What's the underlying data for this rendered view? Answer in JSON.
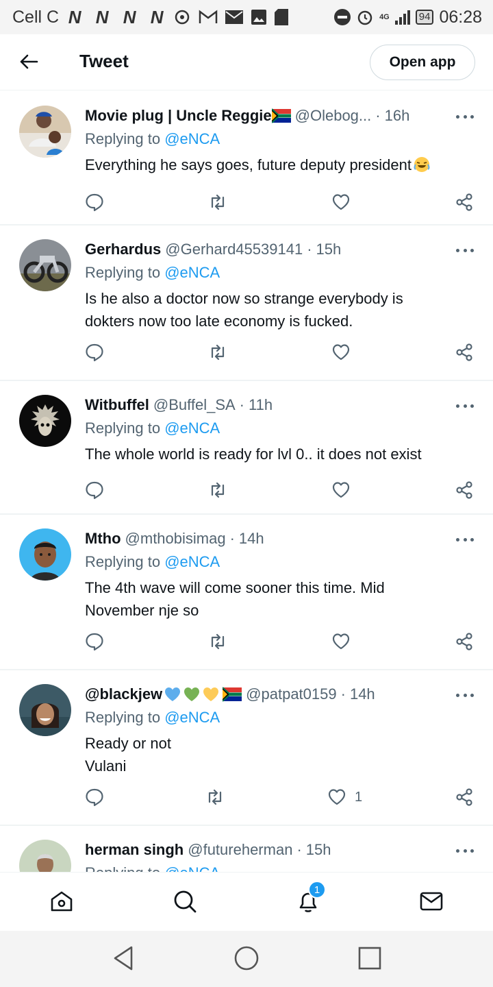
{
  "status_bar": {
    "carrier": "Cell C",
    "network": "4G",
    "battery": "94",
    "time": "06:28"
  },
  "header": {
    "back_icon": "arrow-left-icon",
    "title": "Tweet",
    "open_app_label": "Open app"
  },
  "tweets": [
    {
      "name": "Movie plug | Uncle Reggie",
      "handle": "@Olebog...",
      "time": "16h",
      "replying_prefix": "Replying to",
      "replying_to": "@eNCA",
      "text": "Everything he says goes, future deputy president",
      "like_count": ""
    },
    {
      "name": "Gerhardus",
      "handle": "@Gerhard45539141",
      "time": "15h",
      "replying_prefix": "Replying to",
      "replying_to": "@eNCA",
      "text": "Is he also a doctor now so strange everybody is dokters now too late economy is fucked.",
      "like_count": ""
    },
    {
      "name": "Witbuffel",
      "handle": "@Buffel_SA",
      "time": "11h",
      "replying_prefix": "Replying to",
      "replying_to": "@eNCA",
      "text": "The whole world is ready for lvl 0.. it does not exist",
      "like_count": ""
    },
    {
      "name": "Mtho",
      "handle": "@mthobisimag",
      "time": "14h",
      "replying_prefix": "Replying to",
      "replying_to": "@eNCA",
      "text": "The 4th wave will come sooner this time. Mid November nje so",
      "like_count": ""
    },
    {
      "name": "@blackjew",
      "handle": "@patpat0159",
      "time": "14h",
      "replying_prefix": "Replying to",
      "replying_to": "@eNCA",
      "text": "Ready or not\nVulani",
      "like_count": "1"
    },
    {
      "name": "herman singh",
      "handle": "@futureherman",
      "time": "15h",
      "replying_prefix": "Replying to",
      "replying_to": "@eNCA",
      "text": "",
      "like_count": ""
    }
  ],
  "bottom_nav": {
    "items": [
      "home-icon",
      "search-icon",
      "notifications-icon",
      "messages-icon"
    ],
    "notification_badge": "1"
  },
  "system_nav": {
    "items": [
      "back-triangle-icon",
      "home-circle-icon",
      "recents-square-icon"
    ]
  },
  "colors": {
    "accent": "#1d9bf0",
    "text": "#0f1419",
    "secondary": "#536471",
    "divider": "#eff3f4"
  }
}
